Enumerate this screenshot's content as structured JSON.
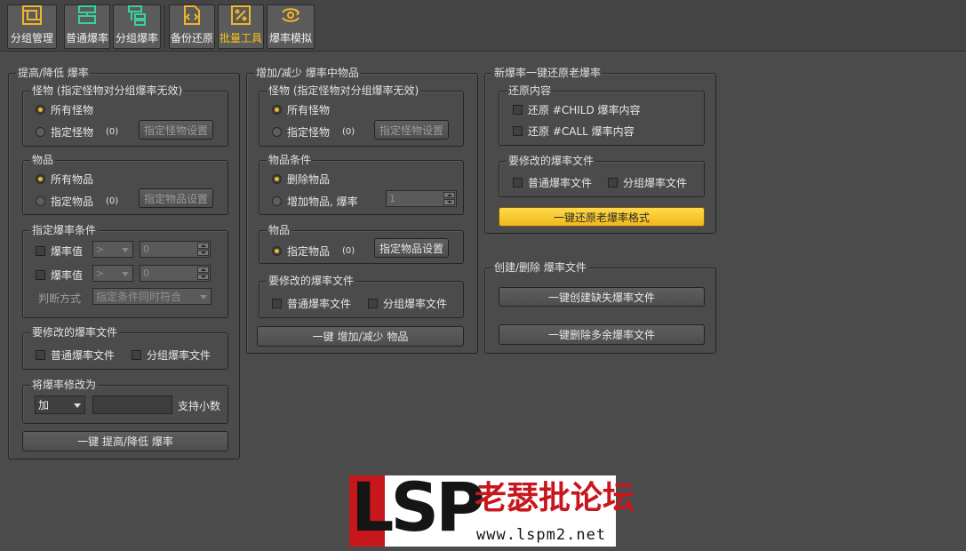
{
  "toolbar": {
    "items": [
      {
        "label": "分组管理",
        "icon": "group-manage-icon"
      },
      {
        "label": "普通爆率",
        "icon": "normal-drop-icon"
      },
      {
        "label": "分组爆率",
        "icon": "group-drop-icon"
      },
      {
        "label": "备份还原",
        "icon": "backup-restore-icon"
      },
      {
        "label": "批量工具",
        "icon": "batch-tool-icon",
        "active": true
      },
      {
        "label": "爆率模拟",
        "icon": "drop-simulate-icon"
      }
    ]
  },
  "panel1": {
    "title": "提高/降低 爆率",
    "monster": {
      "title": "怪物 (指定怪物对分组爆率无效)",
      "all": "所有怪物",
      "specified": "指定怪物",
      "count": "(0)",
      "button": "指定怪物设置",
      "selected": "all"
    },
    "item": {
      "title": "物品",
      "all": "所有物品",
      "specified": "指定物品",
      "count": "(0)",
      "button": "指定物品设置",
      "selected": "all"
    },
    "condition": {
      "title": "指定爆率条件",
      "rows": [
        {
          "label": "爆率值",
          "op": ">",
          "value": "0"
        },
        {
          "label": "爆率值",
          "op": ">",
          "value": "0"
        }
      ],
      "judge_label": "判断方式",
      "judge_value": "指定条件同时符合"
    },
    "files": {
      "title": "要修改的爆率文件",
      "normal": "普通爆率文件",
      "group": "分组爆率文件"
    },
    "modify": {
      "title": "将爆率修改为",
      "mode": "加",
      "value": "",
      "hint": "支持小数"
    },
    "action": "一键 提高/降低 爆率"
  },
  "panel2": {
    "title": "增加/减少 爆率中物品",
    "monster": {
      "title": "怪物 (指定怪物对分组爆率无效)",
      "all": "所有怪物",
      "specified": "指定怪物",
      "count": "(0)",
      "button": "指定怪物设置",
      "selected": "all"
    },
    "item_condition": {
      "title": "物品条件",
      "delete": "删除物品",
      "add": "增加物品, 爆率",
      "rate": "1",
      "selected": "delete"
    },
    "item": {
      "title": "物品",
      "specified": "指定物品",
      "count": "(0)",
      "button": "指定物品设置",
      "selected": "specified"
    },
    "files": {
      "title": "要修改的爆率文件",
      "normal": "普通爆率文件",
      "group": "分组爆率文件"
    },
    "action": "一键 增加/减少 物品"
  },
  "panel3": {
    "title": "新爆率一键还原老爆率",
    "restore": {
      "title": "还原内容",
      "child": "还原 #CHILD 爆率内容",
      "call": "还原 #CALL 爆率内容"
    },
    "files": {
      "title": "要修改的爆率文件",
      "normal": "普通爆率文件",
      "group": "分组爆率文件"
    },
    "action": "一键还原老爆率格式"
  },
  "panel4": {
    "title": "创建/删除 爆率文件",
    "create": "一键创建缺失爆率文件",
    "delete": "一键删除多余爆率文件"
  },
  "watermark": {
    "logo": "LSP",
    "name": "老瑟批论坛",
    "url": "www.lspm2.net"
  }
}
